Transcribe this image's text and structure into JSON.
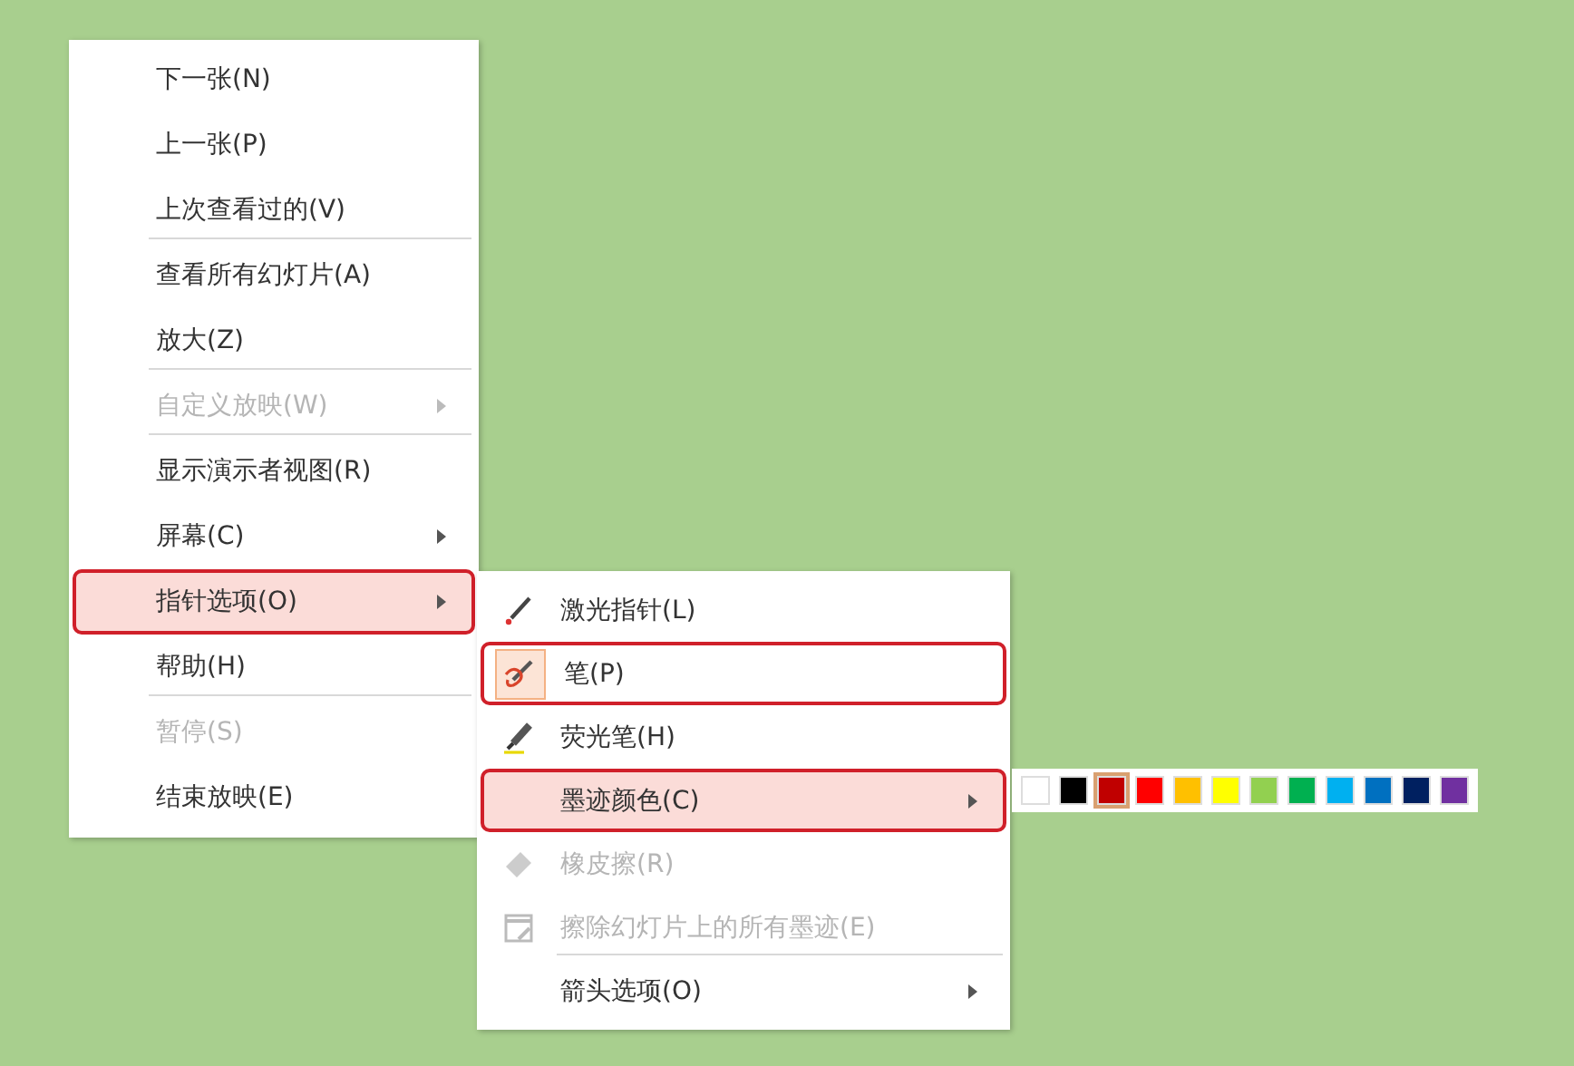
{
  "context_menu": {
    "items": [
      {
        "label": "下一张(N)",
        "disabled": false,
        "has_submenu": false,
        "selected": false,
        "annotated": false,
        "separator_after": false
      },
      {
        "label": "上一张(P)",
        "disabled": false,
        "has_submenu": false,
        "selected": false,
        "annotated": false,
        "separator_after": false
      },
      {
        "label": "上次查看过的(V)",
        "disabled": false,
        "has_submenu": false,
        "selected": false,
        "annotated": false,
        "separator_after": true
      },
      {
        "label": "查看所有幻灯片(A)",
        "disabled": false,
        "has_submenu": false,
        "selected": false,
        "annotated": false,
        "separator_after": false
      },
      {
        "label": "放大(Z)",
        "disabled": false,
        "has_submenu": false,
        "selected": false,
        "annotated": false,
        "separator_after": true
      },
      {
        "label": "自定义放映(W)",
        "disabled": true,
        "has_submenu": true,
        "selected": false,
        "annotated": false,
        "separator_after": true
      },
      {
        "label": "显示演示者视图(R)",
        "disabled": false,
        "has_submenu": false,
        "selected": false,
        "annotated": false,
        "separator_after": false
      },
      {
        "label": "屏幕(C)",
        "disabled": false,
        "has_submenu": true,
        "selected": false,
        "annotated": false,
        "separator_after": false
      },
      {
        "label": "指针选项(O)",
        "disabled": false,
        "has_submenu": true,
        "selected": true,
        "annotated": true,
        "separator_after": false
      },
      {
        "label": "帮助(H)",
        "disabled": false,
        "has_submenu": false,
        "selected": false,
        "annotated": false,
        "separator_after": true
      },
      {
        "label": "暂停(S)",
        "disabled": true,
        "has_submenu": false,
        "selected": false,
        "annotated": false,
        "separator_after": false
      },
      {
        "label": "结束放映(E)",
        "disabled": false,
        "has_submenu": false,
        "selected": false,
        "annotated": false,
        "separator_after": false
      }
    ]
  },
  "pointer_submenu": {
    "items": [
      {
        "kind": "laser",
        "label": "激光指针(L)",
        "disabled": false,
        "checked": false,
        "has_submenu": false,
        "selected": false,
        "annotated": false,
        "separator_after": false
      },
      {
        "kind": "pen",
        "label": "笔(P)",
        "disabled": false,
        "checked": true,
        "has_submenu": false,
        "selected": false,
        "annotated": true,
        "separator_after": false
      },
      {
        "kind": "highlighter",
        "label": "荧光笔(H)",
        "disabled": false,
        "checked": false,
        "has_submenu": false,
        "selected": false,
        "annotated": false,
        "separator_after": false
      },
      {
        "kind": "none",
        "label": "墨迹颜色(C)",
        "disabled": false,
        "checked": false,
        "has_submenu": true,
        "selected": true,
        "annotated": true,
        "separator_after": false
      },
      {
        "kind": "eraser",
        "label": "橡皮擦(R)",
        "disabled": true,
        "checked": false,
        "has_submenu": false,
        "selected": false,
        "annotated": false,
        "separator_after": false
      },
      {
        "kind": "clear",
        "label": "擦除幻灯片上的所有墨迹(E)",
        "disabled": true,
        "checked": false,
        "has_submenu": false,
        "selected": false,
        "annotated": false,
        "separator_after": true
      },
      {
        "kind": "none",
        "label": "箭头选项(O)",
        "disabled": false,
        "checked": false,
        "has_submenu": true,
        "selected": false,
        "annotated": false,
        "separator_after": false
      }
    ]
  },
  "ink_colors": [
    {
      "color": "#ffffff",
      "selected": false
    },
    {
      "color": "#000000",
      "selected": false
    },
    {
      "color": "#c00000",
      "selected": true
    },
    {
      "color": "#ff0000",
      "selected": false
    },
    {
      "color": "#ffc000",
      "selected": false
    },
    {
      "color": "#ffff00",
      "selected": false
    },
    {
      "color": "#92d050",
      "selected": false
    },
    {
      "color": "#00b050",
      "selected": false
    },
    {
      "color": "#00b0f0",
      "selected": false
    },
    {
      "color": "#0070c0",
      "selected": false
    },
    {
      "color": "#002060",
      "selected": false
    },
    {
      "color": "#7030a0",
      "selected": false
    }
  ]
}
